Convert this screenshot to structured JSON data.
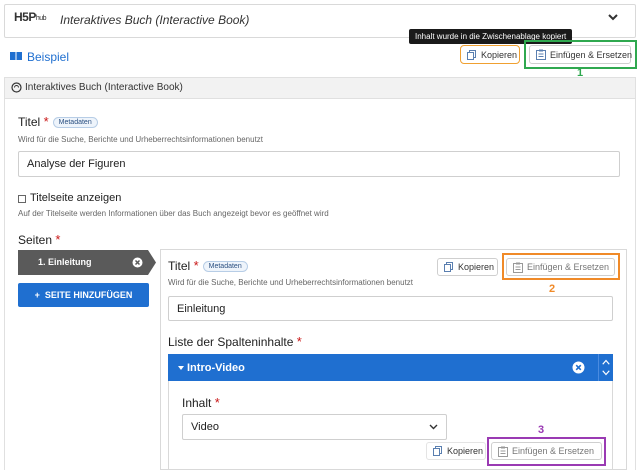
{
  "header": {
    "logo_main": "H5P",
    "logo_sub": "hub",
    "title": "Interaktives Buch (Interactive Book)"
  },
  "beispiel_link": "Beispiel",
  "clipboard_tooltip": "Inhalt wurde in die Zwischenablage kopiert",
  "actions": {
    "copy_label": "Kopieren",
    "paste_replace_label": "Einfügen & Ersetzen"
  },
  "annotations": {
    "one": "1",
    "two": "2",
    "three": "3",
    "color_green": "#2fa84f",
    "color_orange": "#f08a28",
    "color_purple": "#9a3ab3"
  },
  "section": {
    "title": "Interaktives Buch (Interactive Book)"
  },
  "form": {
    "title_label": "Titel",
    "required_mark": "*",
    "metadata_badge": "Metadaten",
    "title_description": "Wird für die Suche, Berichte und Urheberrechtsinformationen benutzt",
    "title_value": "Analyse der Figuren",
    "cover_checkbox_label": "Titelseite anzeigen",
    "cover_description": "Auf der Titelseite werden Informationen über das Buch angezeigt bevor es geöffnet wird",
    "pages_label": "Seiten"
  },
  "chapters": [
    {
      "label": "1. Einleitung"
    }
  ],
  "add_page_button": "SEITE HINZUFÜGEN",
  "chapter_editor": {
    "title_label": "Titel",
    "metadata_badge": "Metadaten",
    "title_description": "Wird für die Suche, Berichte und Urheberrechtsinformationen benutzt",
    "title_value": "Einleitung",
    "content_list_label": "Liste der Spalteninhalte",
    "item_title": "Intro-Video",
    "content_label": "Inhalt",
    "content_select_value": "Video"
  },
  "colors": {
    "primary_blue": "#1f6fd0",
    "required_red": "#c91515",
    "chapter_tab": "#5a5a5a"
  }
}
